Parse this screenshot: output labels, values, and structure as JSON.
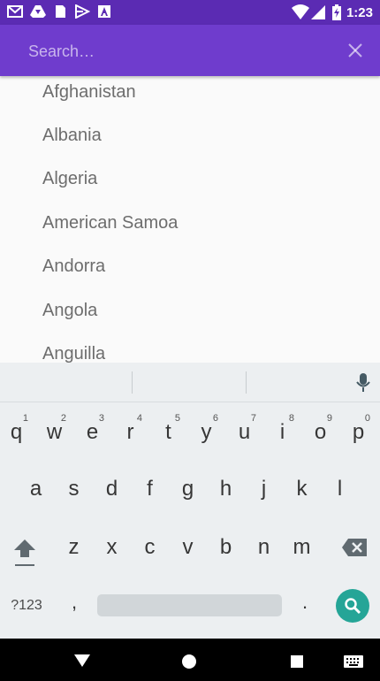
{
  "status_bar": {
    "time": "1:23",
    "icons": [
      "gmail-icon",
      "drive-icon",
      "file-icon",
      "play-icon",
      "a-icon",
      "wifi-icon",
      "signal-icon",
      "battery-icon"
    ]
  },
  "search": {
    "placeholder": "Search…",
    "value": ""
  },
  "countries": [
    "Afghanistan",
    "Albania",
    "Algeria",
    "American Samoa",
    "Andorra",
    "Angola",
    "Anguilla"
  ],
  "keyboard": {
    "row1": [
      {
        "key": "q",
        "hint": "1"
      },
      {
        "key": "w",
        "hint": "2"
      },
      {
        "key": "e",
        "hint": "3"
      },
      {
        "key": "r",
        "hint": "4"
      },
      {
        "key": "t",
        "hint": "5"
      },
      {
        "key": "y",
        "hint": "6"
      },
      {
        "key": "u",
        "hint": "7"
      },
      {
        "key": "i",
        "hint": "8"
      },
      {
        "key": "o",
        "hint": "9"
      },
      {
        "key": "p",
        "hint": "0"
      }
    ],
    "row2": [
      "a",
      "s",
      "d",
      "f",
      "g",
      "h",
      "j",
      "k",
      "l"
    ],
    "row3": [
      "z",
      "x",
      "c",
      "v",
      "b",
      "n",
      "m"
    ],
    "symbols_key": "?123",
    "comma_key": ",",
    "period_key": "."
  },
  "colors": {
    "status_bar": "#5b2bb3",
    "toolbar": "#6f3ccd",
    "search_key": "#25a597",
    "list_text": "#6d6d6d"
  }
}
